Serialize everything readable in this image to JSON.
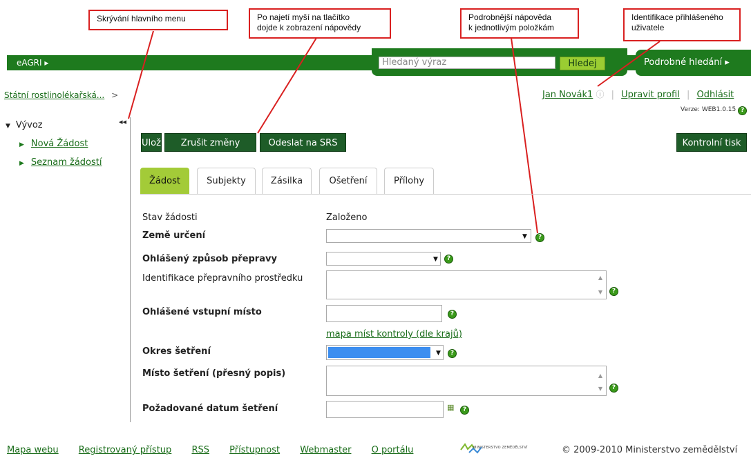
{
  "callouts": {
    "menu": "Skrývání hlavního menu",
    "help_line1": "Po najetí myší na tlačítko",
    "help_line2": "dojde k zobrazení nápovědy",
    "detail_line1": "Podrobnější nápověda",
    "detail_line2": "k jednotlivým položkám",
    "user_line1": "Identifikace přihlášeného",
    "user_line2": "uživatele"
  },
  "topbar": {
    "home_label": "eAGRI",
    "search_placeholder": "Hledaný výraz",
    "search_button": "Hledej",
    "advanced_search": "Podrobné hledání"
  },
  "breadcrumb": {
    "item": "Státní rostlinolékařská...",
    "separator": ">"
  },
  "user": {
    "name": "Jan Novák1",
    "edit_profile": "Upravit profil",
    "logout": "Odhlásit",
    "version": "Verze: WEB1.0.15"
  },
  "sidebar": {
    "title": "Vývoz",
    "items": [
      {
        "label": "Nová Žádost"
      },
      {
        "label": "Seznam žádostí"
      }
    ]
  },
  "toolbar": {
    "save": "Uložit",
    "cancel": "Zrušit změny",
    "send": "Odeslat na SRS",
    "print": "Kontrolní tisk"
  },
  "tabs": [
    "Žádost",
    "Subjekty",
    "Zásilka",
    "Ošetření",
    "Přílohy"
  ],
  "form": {
    "status_label": "Stav žádosti",
    "status_value": "Založeno",
    "country_label": "Země určení",
    "transport_label": "Ohlášený způsob přepravy",
    "vehicle_label": "Identifikace přepravního prostředku",
    "entry_point_label": "Ohlášené vstupní místo",
    "map_link": "mapa míst kontroly (dle krajů)",
    "district_label": "Okres šetření",
    "place_label": "Místo šetření (přesný popis)",
    "date_label": "Požadované datum šetření"
  },
  "footer": {
    "links": [
      "Mapa webu",
      "Registrovaný přístup",
      "RSS",
      "Přístupnost",
      "Webmaster",
      "O portálu"
    ],
    "ministry_text": "MINISTERSTVO ZEMĚDĚLSTVÍ",
    "copyright": "© 2009-2010 Ministerstvo zemědělství"
  },
  "colors": {
    "brand_green": "#1e7a1e",
    "accent_lime": "#a3cb38",
    "callout_red": "#d92020"
  }
}
